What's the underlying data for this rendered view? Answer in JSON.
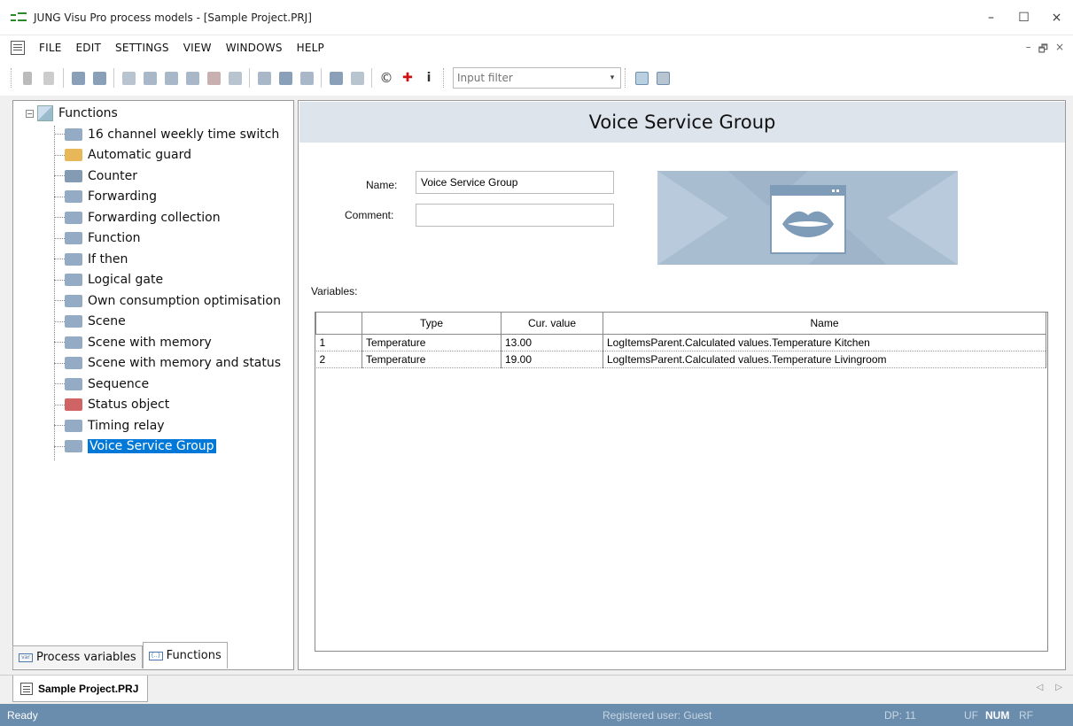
{
  "window": {
    "title": "JUNG Visu Pro process models - [Sample Project.PRJ]",
    "minimize": "–",
    "maximize": "☐",
    "close": "×"
  },
  "menu": {
    "items": [
      "FILE",
      "EDIT",
      "SETTINGS",
      "VIEW",
      "WINDOWS",
      "HELP"
    ],
    "mdi_min": "–",
    "mdi_restore": "🗗",
    "mdi_close": "×"
  },
  "toolbar": {
    "input_filter_placeholder": "Input filter",
    "dropdown_glyph": "▾",
    "copyright_glyph": "©",
    "plus_glyph": "✚",
    "info_glyph": "i"
  },
  "tree": {
    "root_label": "Functions",
    "expander": "−",
    "items": [
      {
        "label": "16 channel weekly time switch",
        "icon": "weekly-timer-icon",
        "color": "#6f8fb0"
      },
      {
        "label": "Automatic guard",
        "icon": "warning-triangle-icon",
        "color": "#e0a020"
      },
      {
        "label": "Counter",
        "icon": "counter-icon",
        "color": "#5a7a9a"
      },
      {
        "label": "Forwarding",
        "icon": "forward-arrow-icon",
        "color": "#6f8fb0"
      },
      {
        "label": "Forwarding collection",
        "icon": "forward-collection-icon",
        "color": "#6f8fb0"
      },
      {
        "label": "Function",
        "icon": "function-icon",
        "color": "#6f8fb0"
      },
      {
        "label": "If then",
        "icon": "if-then-icon",
        "color": "#6f8fb0"
      },
      {
        "label": "Logical gate",
        "icon": "logical-gate-icon",
        "color": "#6f8fb0"
      },
      {
        "label": "Own consumption optimisation",
        "icon": "consumption-icon",
        "color": "#6f8fb0"
      },
      {
        "label": "Scene",
        "icon": "scene-icon",
        "color": "#6f8fb0"
      },
      {
        "label": "Scene with memory",
        "icon": "scene-memory-icon",
        "color": "#6f8fb0"
      },
      {
        "label": "Scene with memory and status",
        "icon": "scene-memory-status-icon",
        "color": "#6f8fb0"
      },
      {
        "label": "Sequence",
        "icon": "sequence-icon",
        "color": "#6f8fb0"
      },
      {
        "label": "Status object",
        "icon": "status-object-icon",
        "color": "#c03030"
      },
      {
        "label": "Timing relay",
        "icon": "timing-relay-icon",
        "color": "#6f8fb0"
      },
      {
        "label": "Voice Service Group",
        "icon": "lips-icon",
        "color": "#6f8fb0",
        "selected": true
      }
    ]
  },
  "left_tabs": [
    {
      "label": "Process variables",
      "icon_text": "var",
      "active": false
    },
    {
      "label": "Functions",
      "icon_text": "{..}",
      "active": true
    }
  ],
  "detail": {
    "heading": "Voice Service Group",
    "name_label": "Name:",
    "name_value": "Voice Service Group",
    "comment_label": "Comment:",
    "comment_value": "",
    "variables_label": "Variables:"
  },
  "variables_table": {
    "columns": [
      "",
      "Type",
      "Cur. value",
      "Name"
    ],
    "rows": [
      {
        "num": "1",
        "type": "Temperature",
        "value": "13.00",
        "name": "LogItemsParent.Calculated values.Temperature Kitchen"
      },
      {
        "num": "2",
        "type": "Temperature",
        "value": "19.00",
        "name": "LogItemsParent.Calculated values.Temperature Livingroom"
      }
    ]
  },
  "doc_tab": {
    "label": "Sample Project.PRJ",
    "nav_left": "◁",
    "nav_right": "▷"
  },
  "status": {
    "ready": "Ready",
    "user": "Registered user: Guest",
    "dp": "DP: 11",
    "uf": "UF",
    "num": "NUM",
    "rf": "RF"
  },
  "colors": {
    "selection": "#0078d7",
    "status_bar": "#6a8cad",
    "header_band": "#dde4ec",
    "graphic_bg": "#a9bdd0"
  }
}
